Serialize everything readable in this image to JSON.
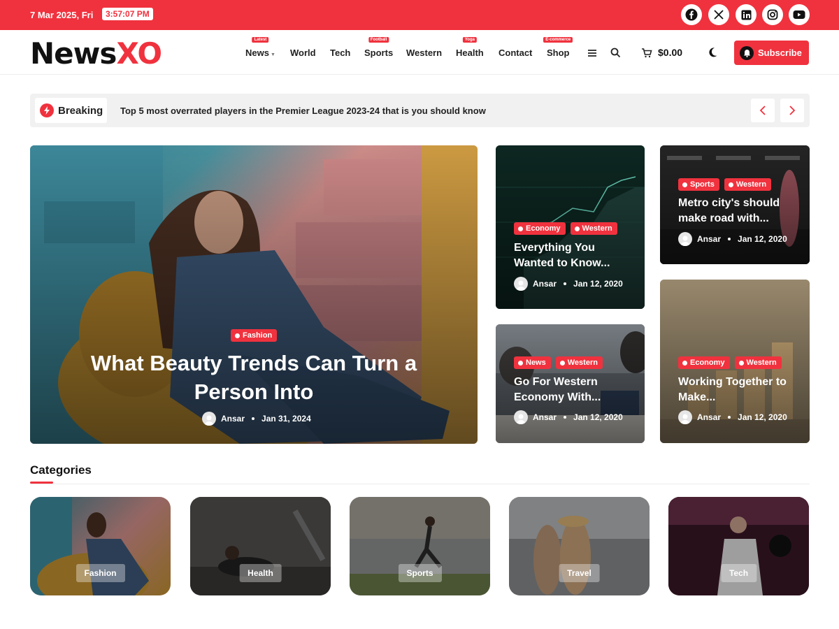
{
  "topbar": {
    "date": "7 Mar 2025, Fri",
    "time": "3:57:07 PM",
    "social_icons": [
      "facebook-icon",
      "x-icon",
      "linkedin-icon",
      "instagram-icon",
      "youtube-icon"
    ]
  },
  "brand": {
    "name_part1": "News",
    "name_part2": "XO"
  },
  "nav": [
    {
      "label": "News",
      "badge": "Latest"
    },
    {
      "label": "World",
      "badge": ""
    },
    {
      "label": "Tech",
      "badge": ""
    },
    {
      "label": "Sports",
      "badge": "Football"
    },
    {
      "label": "Western",
      "badge": ""
    },
    {
      "label": "Health",
      "badge": "Yoga"
    },
    {
      "label": "Contact",
      "badge": ""
    },
    {
      "label": "Shop",
      "badge": "E-commerce"
    }
  ],
  "cart": {
    "total": "$0.00"
  },
  "subscribe_label": "Subscribe",
  "breaking": {
    "label": "Breaking",
    "text": "Top 5 most overrated players in the Premier League 2023-24 that is you should know"
  },
  "hero": {
    "tag": "Fashion",
    "title": "What Beauty Trends Can Turn a Person Into",
    "author": "Ansar",
    "date": "Jan 31, 2024"
  },
  "cards": [
    {
      "tags": [
        "Economy",
        "Western"
      ],
      "title": "Everything You Wanted to Know...",
      "author": "Ansar",
      "date": "Jan 12, 2020"
    },
    {
      "tags": [
        "Sports",
        "Western"
      ],
      "title": "Metro city's should make road with...",
      "author": "Ansar",
      "date": "Jan 12, 2020"
    },
    {
      "tags": [
        "News",
        "Western"
      ],
      "title": "Go For Western Economy With...",
      "author": "Ansar",
      "date": "Jan 12, 2020"
    },
    {
      "tags": [
        "Economy",
        "Western"
      ],
      "title": "Working Together to Make...",
      "author": "Ansar",
      "date": "Jan 12, 2020"
    }
  ],
  "categories": {
    "heading": "Categories",
    "items": [
      "Fashion",
      "Health",
      "Sports",
      "Travel",
      "Tech"
    ]
  },
  "colors": {
    "accent": "#f0323e"
  }
}
